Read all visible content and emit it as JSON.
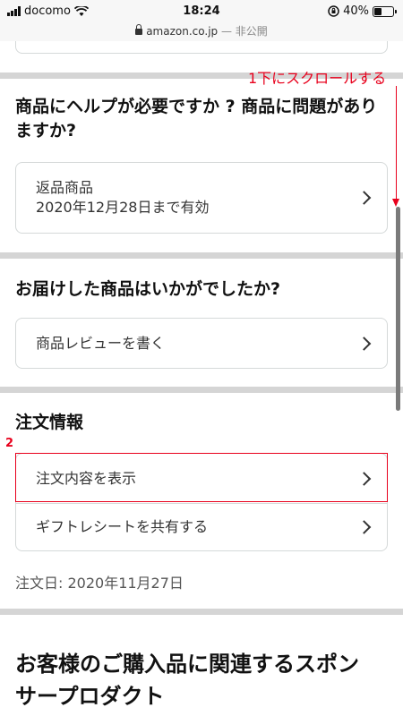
{
  "status_bar": {
    "carrier": "docomo",
    "time": "18:24",
    "battery": "40%",
    "battery_level": 0.4
  },
  "url_bar": {
    "domain": "amazon.co.jp",
    "suffix": "— 非公開"
  },
  "help_section": {
    "title": "商品にヘルプが必要ですか ? 商品に問題がありますか?",
    "return_item_label": "返品商品",
    "return_item_sub": "2020年12月28日まで有効"
  },
  "review_section": {
    "title": "お届けした商品はいかがでしたか?",
    "write_review": "商品レビューを書く"
  },
  "order_info": {
    "title": "注文情報",
    "view_order": "注文内容を表示",
    "share_gift_receipt": "ギフトレシートを共有する",
    "order_date": "注文日: 2020年11月27日"
  },
  "sponsored": {
    "title": "お客様のご購入品に関連するスポンサープロダクト"
  },
  "annotations": {
    "step1": "1下にスクロールする",
    "step2": "2",
    "color": "#e8001c"
  }
}
